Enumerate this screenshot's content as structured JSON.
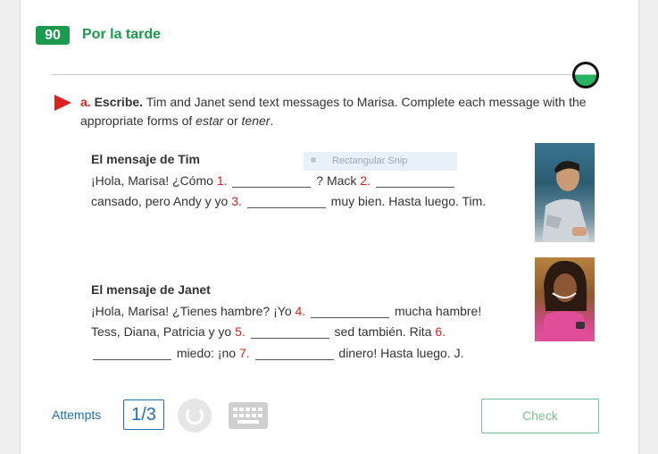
{
  "lesson": {
    "number": "90",
    "title": "Por la tarde"
  },
  "instruction": {
    "letter": "a.",
    "bold": "Escribe.",
    "text1": " Tim and Janet send text messages to Marisa. Complete each message with the appropriate forms of ",
    "word1": "estar",
    "text2": " or ",
    "word2": "tener",
    "text3": "."
  },
  "messages": [
    {
      "heading": "El mensaje de Tim",
      "parts": {
        "p1": "¡Hola, Marisa! ¿Cómo ",
        "n1": "1.",
        "p2": " ? Mack ",
        "n2": "2.",
        "p3": "cansado, pero Andy y yo ",
        "n3": "3.",
        "p4": " muy bien. Hasta luego. Tim."
      }
    },
    {
      "heading": "El mensaje de Janet",
      "parts": {
        "p1": "¡Hola, Marisa! ¿Tienes hambre? ¡Yo ",
        "n4": "4.",
        "p2": " mucha hambre! Tess, Diana, Patricia y yo ",
        "n5": "5.",
        "p3": " sed también. Rita ",
        "n6": "6.",
        "p4": " miedo: ¡no ",
        "n7": "7.",
        "p5": " dinero! Hasta luego. J."
      }
    }
  ],
  "overlay": {
    "snip_label": "Rectangular Snip"
  },
  "footer": {
    "attempts_label": "Attempts",
    "attempts_value": "1/3",
    "check_label": "Check"
  },
  "colors": {
    "green": "#1a9a4a",
    "red": "#e02020",
    "blue": "#1f6fb5",
    "check_green": "#78c08f"
  },
  "progress": {
    "completed_fraction": 0.5
  }
}
